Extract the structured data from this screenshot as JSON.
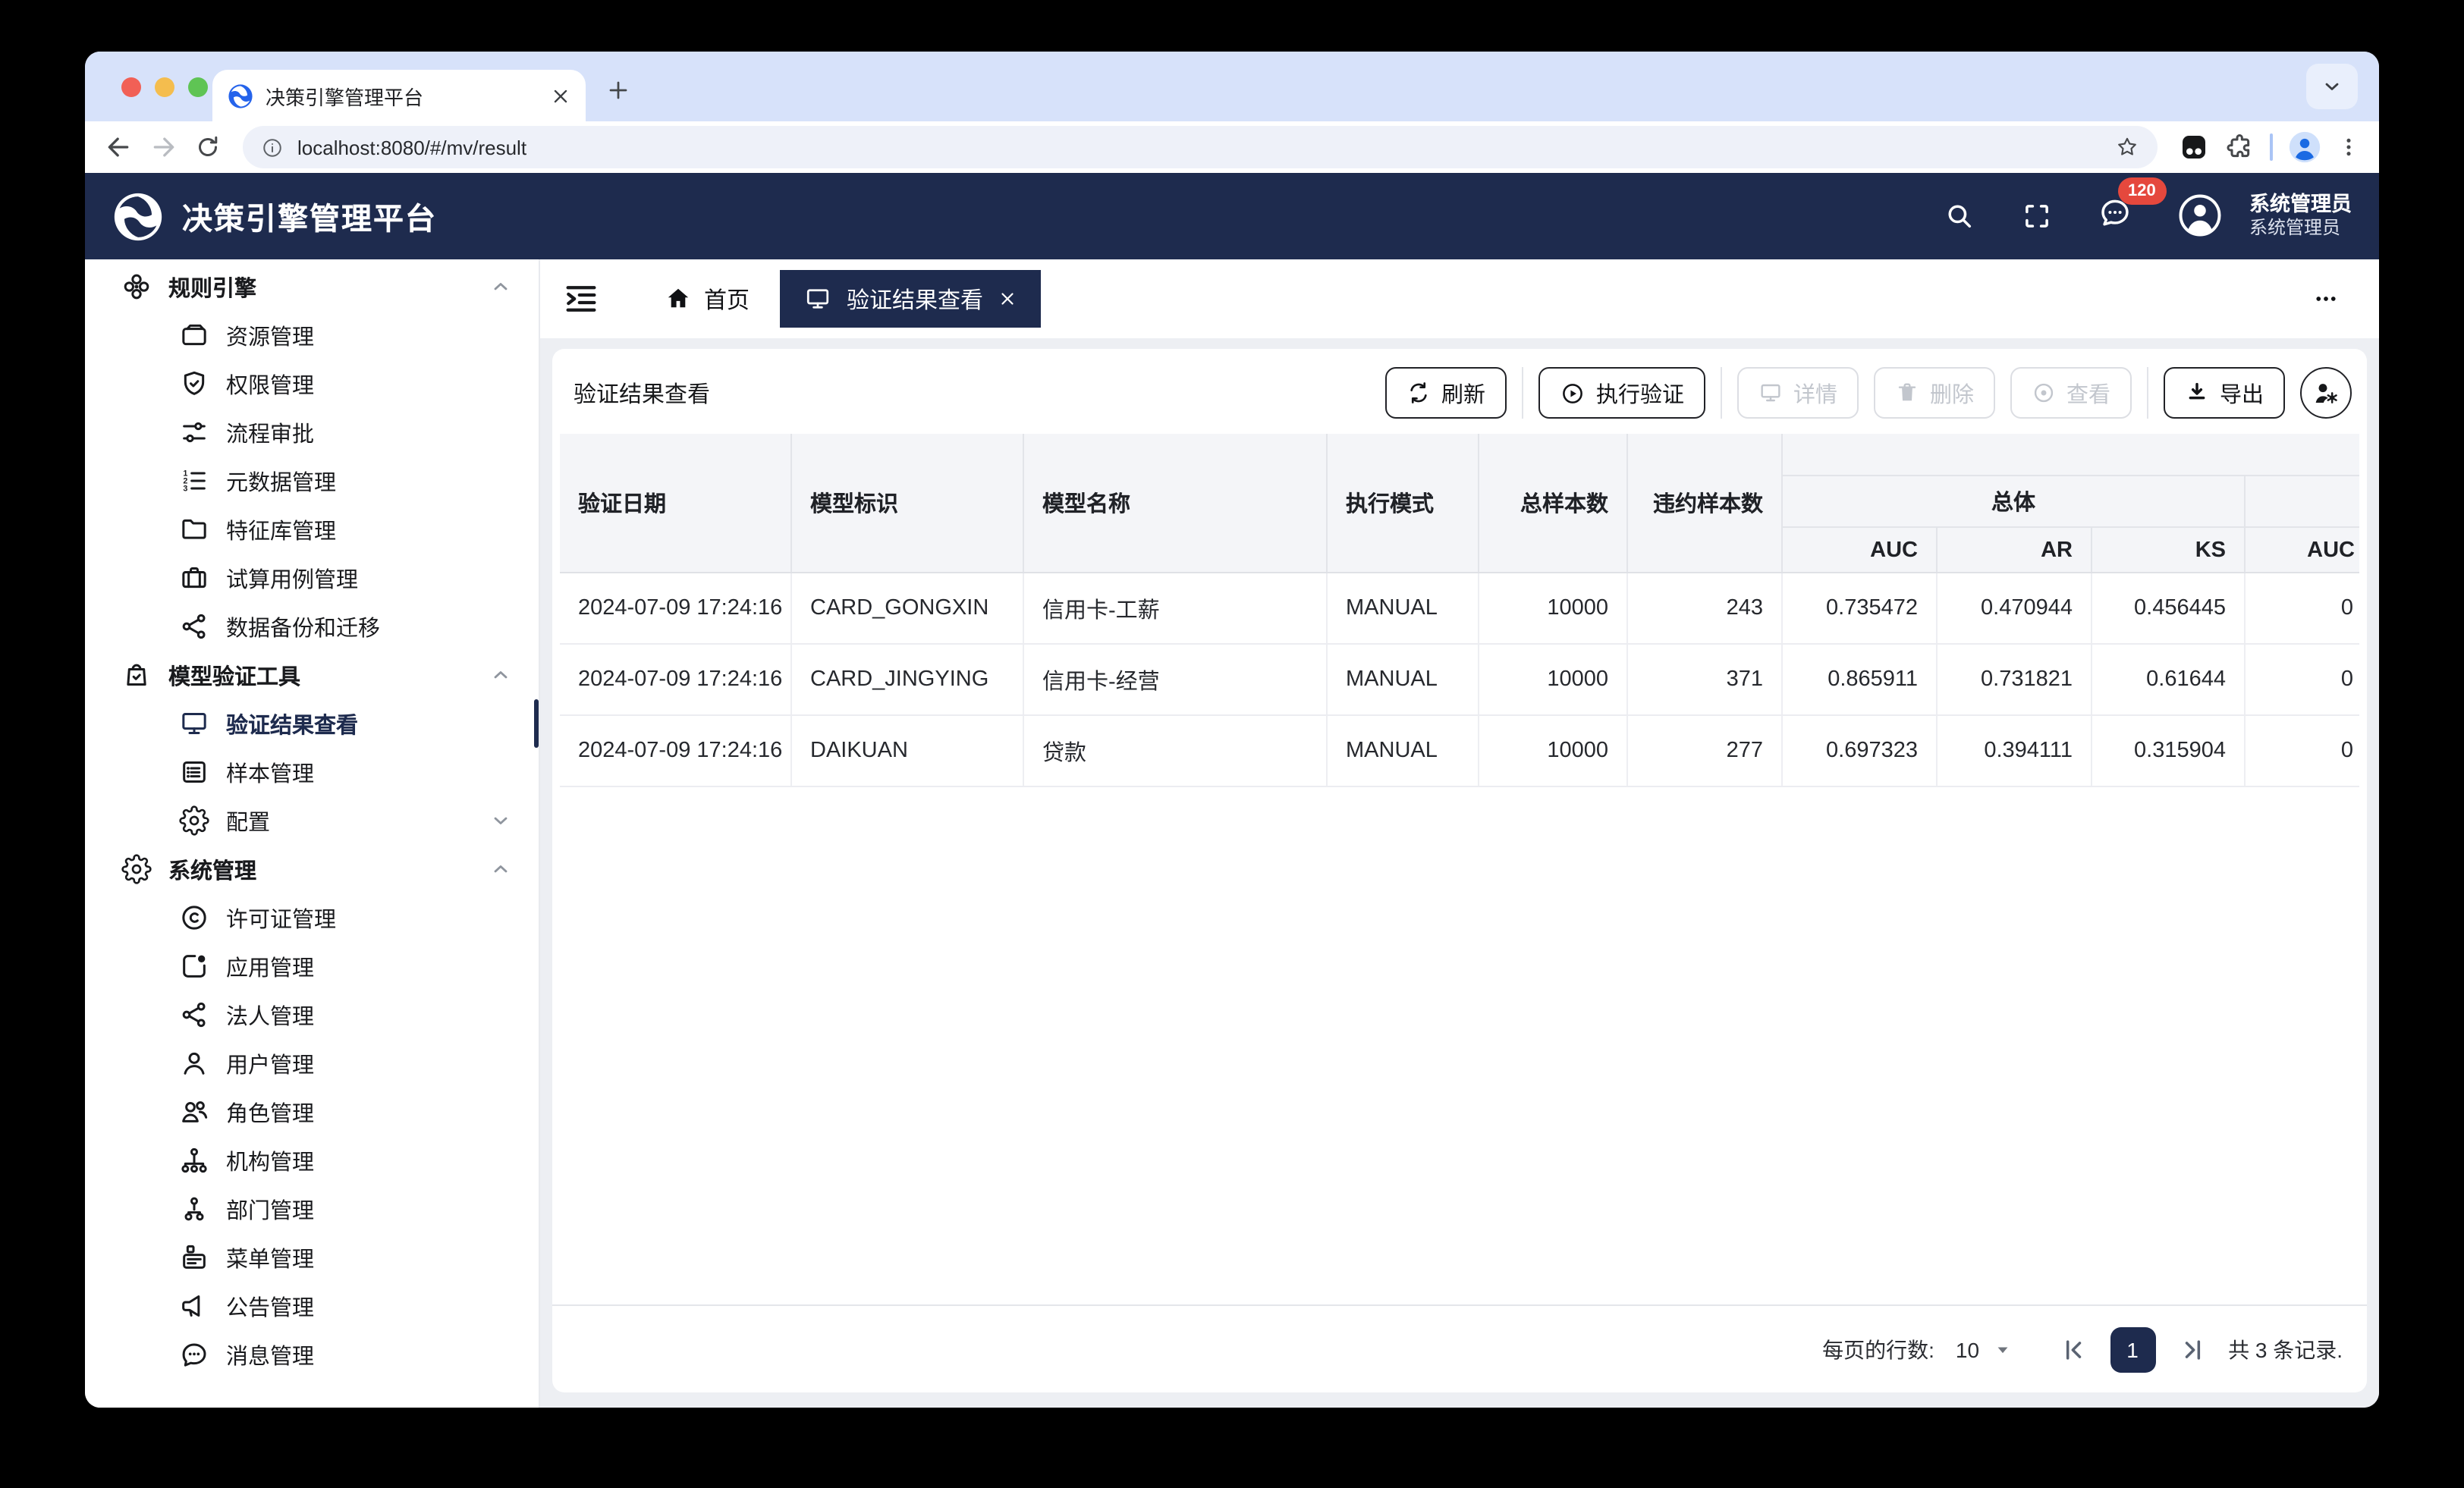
{
  "browser": {
    "tab_title": "决策引擎管理平台",
    "url": "localhost:8080/#/mv/result"
  },
  "header": {
    "title": "决策引擎管理平台",
    "badge": "120",
    "user_line1": "系统管理员",
    "user_line2": "系统管理员"
  },
  "nav_tabs": {
    "home_label": "首页",
    "active_label": "验证结果查看"
  },
  "page": {
    "title": "验证结果查看"
  },
  "toolbar": {
    "refresh": "刷新",
    "run": "执行验证",
    "detail": "详情",
    "delete": "删除",
    "view": "查看",
    "export": "导出"
  },
  "sidebar": {
    "sections": [
      {
        "label": "规则引擎",
        "icon": "cluster",
        "expanded": true,
        "children": [
          {
            "label": "资源管理",
            "icon": "wallet"
          },
          {
            "label": "权限管理",
            "icon": "shield-check"
          },
          {
            "label": "流程审批",
            "icon": "sliders"
          },
          {
            "label": "元数据管理",
            "icon": "list-numbers"
          },
          {
            "label": "特征库管理",
            "icon": "folder"
          },
          {
            "label": "试算用例管理",
            "icon": "briefcase"
          },
          {
            "label": "数据备份和迁移",
            "icon": "share-nodes"
          }
        ]
      },
      {
        "label": "模型验证工具",
        "icon": "bag-check",
        "expanded": true,
        "children": [
          {
            "label": "验证结果查看",
            "icon": "monitor",
            "active": true
          },
          {
            "label": "样本管理",
            "icon": "list-box"
          },
          {
            "label": "配置",
            "icon": "gear",
            "collapsible": true
          }
        ]
      },
      {
        "label": "系统管理",
        "icon": "gear",
        "expanded": true,
        "children": [
          {
            "label": "许可证管理",
            "icon": "copyright"
          },
          {
            "label": "应用管理",
            "icon": "app-window"
          },
          {
            "label": "法人管理",
            "icon": "share-nodes"
          },
          {
            "label": "用户管理",
            "icon": "user"
          },
          {
            "label": "角色管理",
            "icon": "users"
          },
          {
            "label": "机构管理",
            "icon": "org-chart"
          },
          {
            "label": "部门管理",
            "icon": "org-branch"
          },
          {
            "label": "菜单管理",
            "icon": "menu-card"
          },
          {
            "label": "公告管理",
            "icon": "megaphone"
          },
          {
            "label": "消息管理",
            "icon": "chat-dots"
          }
        ]
      }
    ]
  },
  "table": {
    "columns": [
      "验证日期",
      "模型标识",
      "模型名称",
      "执行模式",
      "总样本数",
      "违约样本数"
    ],
    "group_label": "总体",
    "group_cols": [
      "AUC",
      "AR",
      "KS"
    ],
    "partial_col": "AUC",
    "rows": [
      [
        "2024-07-09 17:24:16",
        "CARD_GONGXIN",
        "信用卡-工薪",
        "MANUAL",
        "10000",
        "243",
        "0.735472",
        "0.470944",
        "0.456445",
        "0"
      ],
      [
        "2024-07-09 17:24:16",
        "CARD_JINGYING",
        "信用卡-经营",
        "MANUAL",
        "10000",
        "371",
        "0.865911",
        "0.731821",
        "0.61644",
        "0"
      ],
      [
        "2024-07-09 17:24:16",
        "DAIKUAN",
        "贷款",
        "MANUAL",
        "10000",
        "277",
        "0.697323",
        "0.394111",
        "0.315904",
        "0"
      ]
    ]
  },
  "pagination": {
    "per_page_label": "每页的行数:",
    "per_page": "10",
    "page": "1",
    "total": "共 3 条记录."
  }
}
